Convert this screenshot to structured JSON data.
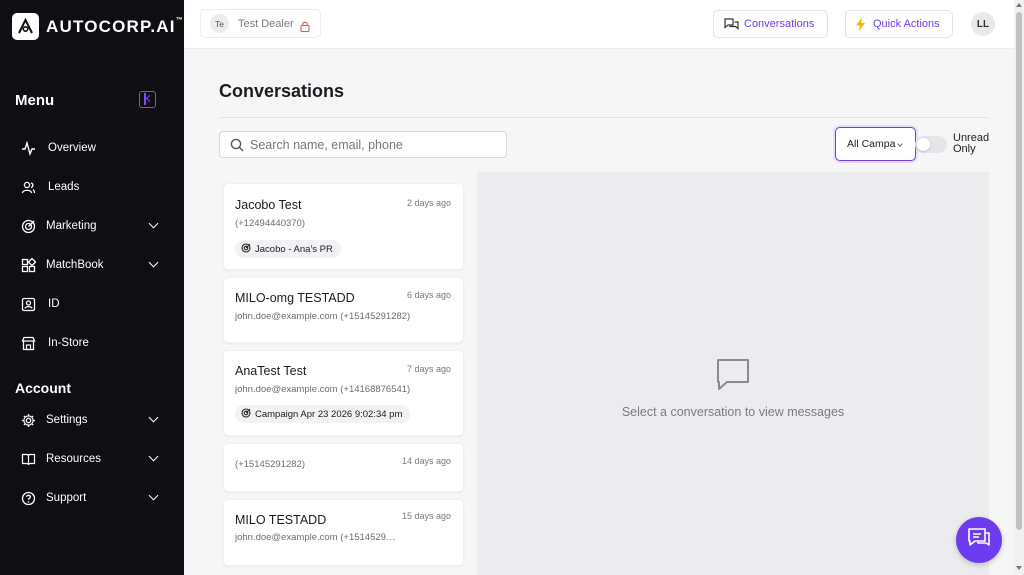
{
  "app": {
    "logo_text": "AUTOCORP.AI",
    "logo_mark": "™"
  },
  "sidebar": {
    "menu_title": "Menu",
    "account_title": "Account",
    "items": [
      {
        "label": "Overview",
        "icon": "activity-icon"
      },
      {
        "label": "Leads",
        "icon": "users-icon"
      },
      {
        "label": "Marketing",
        "icon": "target-icon",
        "expandable": true
      },
      {
        "label": "MatchBook",
        "icon": "grid-icon",
        "expandable": true
      },
      {
        "label": "ID",
        "icon": "id-card-icon"
      },
      {
        "label": "In-Store",
        "icon": "store-icon"
      }
    ],
    "account_items": [
      {
        "label": "Settings",
        "icon": "gear-icon",
        "expandable": true
      },
      {
        "label": "Resources",
        "icon": "book-icon",
        "expandable": true
      },
      {
        "label": "Support",
        "icon": "help-icon",
        "expandable": true
      }
    ]
  },
  "topbar": {
    "dealer_initials": "Te",
    "dealer_name": "Test Dealer",
    "conversations_label": "Conversations",
    "quick_actions_label": "Quick Actions",
    "user_initials": "LL"
  },
  "main": {
    "title": "Conversations",
    "search_placeholder": "Search name, email, phone",
    "campaign_filter": "All Campa",
    "unread_label_1": "Unread",
    "unread_label_2": "Only",
    "unread_only": false,
    "empty_text": "Select a conversation to view messages"
  },
  "conversations": [
    {
      "name": "Jacobo Test",
      "time": "2 days ago",
      "sub": "(+12494440370)",
      "tag": "Jacobo - Ana's PR"
    },
    {
      "name": "MILO-omg TESTADD",
      "time": "6 days ago",
      "sub": "john.doe@example.com (+15145291282)",
      "tag": ""
    },
    {
      "name": "AnaTest Test",
      "time": "7 days ago",
      "sub": "john.doe@example.com (+14168876541)",
      "tag": "Campaign Apr 23 2026 9:02:34 pm"
    },
    {
      "name": "",
      "time": "14 days ago",
      "sub": "(+15145291282)",
      "tag": ""
    },
    {
      "name": "MILO TESTADD",
      "time": "15 days ago",
      "sub": "john.doe@example.com (+1514529128...",
      "tag": ""
    }
  ],
  "colors": {
    "accent": "#6d3cf0",
    "sidebar_bg": "#0e0e13"
  }
}
